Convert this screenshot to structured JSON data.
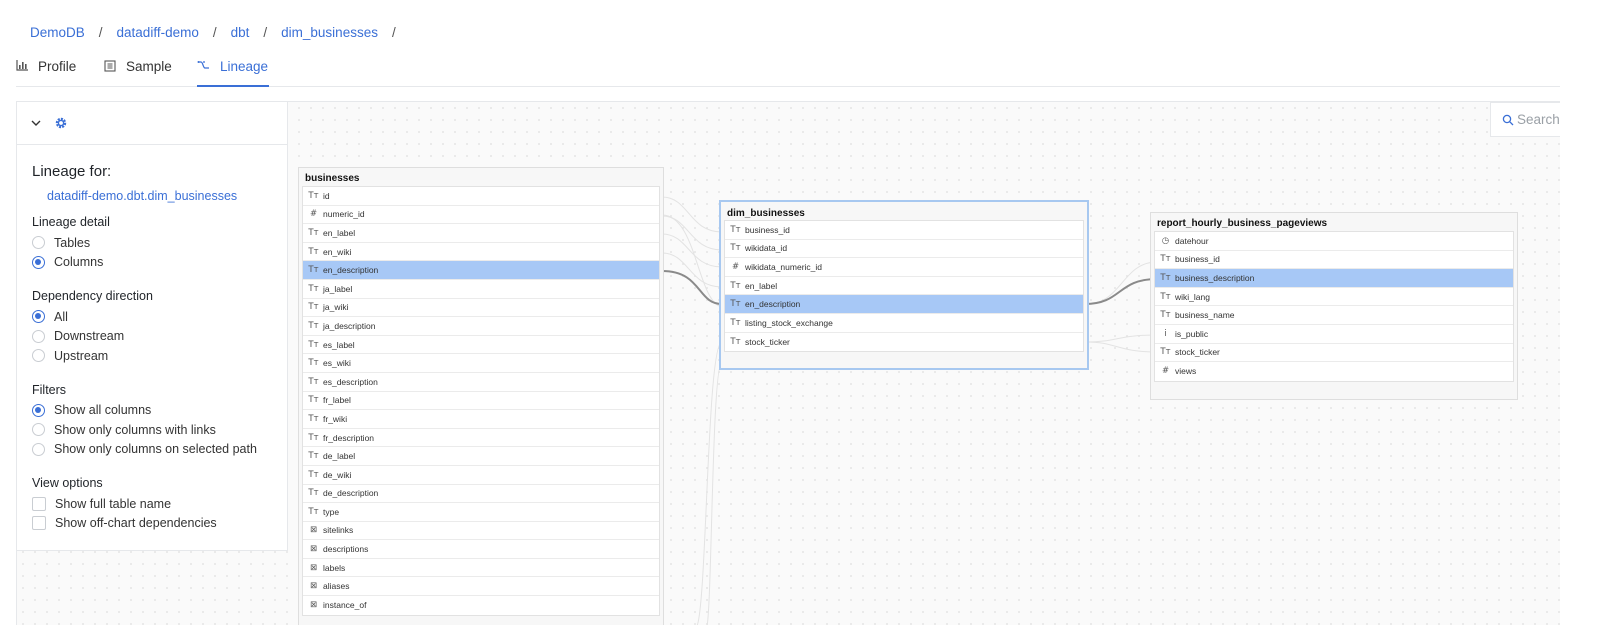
{
  "breadcrumb": [
    "DemoDB",
    "datadiff-demo",
    "dbt",
    "dim_businesses"
  ],
  "breadcrumb_separator": "/",
  "tabs": [
    {
      "label": "Profile",
      "icon": "bar-chart-icon",
      "active": false
    },
    {
      "label": "Sample",
      "icon": "list-icon",
      "active": false
    },
    {
      "label": "Lineage",
      "icon": "lineage-icon",
      "active": true
    }
  ],
  "panel": {
    "title": "Lineage for:",
    "table_path": "datadiff-demo.dbt.dim_businesses",
    "lineage_detail": {
      "label": "Lineage detail",
      "options": [
        "Tables",
        "Columns"
      ],
      "selected": "Columns"
    },
    "dependency_direction": {
      "label": "Dependency direction",
      "options": [
        "All",
        "Downstream",
        "Upstream"
      ],
      "selected": "All"
    },
    "filters": {
      "label": "Filters",
      "options": [
        "Show all columns",
        "Show only columns with links",
        "Show only columns on selected path"
      ],
      "selected": "Show all columns"
    },
    "view_options": {
      "label": "View options",
      "options": [
        "Show full table name",
        "Show off-chart dependencies"
      ],
      "checked": []
    }
  },
  "search": {
    "placeholder": "Search"
  },
  "colors": {
    "accent": "#3a6fd6",
    "highlight": "#a7c8f6",
    "selected_border": "#a7c8f0"
  },
  "nodes": {
    "businesses": {
      "title": "businesses",
      "columns": [
        {
          "name": "id",
          "type_icon": "Tт"
        },
        {
          "name": "numeric_id",
          "type_icon": "#"
        },
        {
          "name": "en_label",
          "type_icon": "Tт"
        },
        {
          "name": "en_wiki",
          "type_icon": "Tт"
        },
        {
          "name": "en_description",
          "type_icon": "Tт",
          "highlighted": true
        },
        {
          "name": "ja_label",
          "type_icon": "Tт"
        },
        {
          "name": "ja_wiki",
          "type_icon": "Tт"
        },
        {
          "name": "ja_description",
          "type_icon": "Tт"
        },
        {
          "name": "es_label",
          "type_icon": "Tт"
        },
        {
          "name": "es_wiki",
          "type_icon": "Tт"
        },
        {
          "name": "es_description",
          "type_icon": "Tт"
        },
        {
          "name": "fr_label",
          "type_icon": "Tт"
        },
        {
          "name": "fr_wiki",
          "type_icon": "Tт"
        },
        {
          "name": "fr_description",
          "type_icon": "Tт"
        },
        {
          "name": "de_label",
          "type_icon": "Tт"
        },
        {
          "name": "de_wiki",
          "type_icon": "Tт"
        },
        {
          "name": "de_description",
          "type_icon": "Tт"
        },
        {
          "name": "type",
          "type_icon": "Tт"
        },
        {
          "name": "sitelinks",
          "type_icon": "⊠"
        },
        {
          "name": "descriptions",
          "type_icon": "⊠"
        },
        {
          "name": "labels",
          "type_icon": "⊠"
        },
        {
          "name": "aliases",
          "type_icon": "⊠"
        },
        {
          "name": "instance_of",
          "type_icon": "⊠"
        }
      ]
    },
    "dim_businesses": {
      "title": "dim_businesses",
      "columns": [
        {
          "name": "business_id",
          "type_icon": "Tт"
        },
        {
          "name": "wikidata_id",
          "type_icon": "Tт"
        },
        {
          "name": "wikidata_numeric_id",
          "type_icon": "#"
        },
        {
          "name": "en_label",
          "type_icon": "Tт"
        },
        {
          "name": "en_description",
          "type_icon": "Tт",
          "highlighted": true
        },
        {
          "name": "listing_stock_exchange",
          "type_icon": "Tт"
        },
        {
          "name": "stock_ticker",
          "type_icon": "Tт"
        }
      ]
    },
    "report": {
      "title": "report_hourly_business_pageviews",
      "columns": [
        {
          "name": "datehour",
          "type_icon": "◷"
        },
        {
          "name": "business_id",
          "type_icon": "Tт"
        },
        {
          "name": "business_description",
          "type_icon": "Tт",
          "highlighted": true
        },
        {
          "name": "wiki_lang",
          "type_icon": "Tт"
        },
        {
          "name": "business_name",
          "type_icon": "Tт"
        },
        {
          "name": "is_public",
          "type_icon": "i"
        },
        {
          "name": "stock_ticker",
          "type_icon": "Tт"
        },
        {
          "name": "views",
          "type_icon": "#"
        }
      ]
    }
  }
}
